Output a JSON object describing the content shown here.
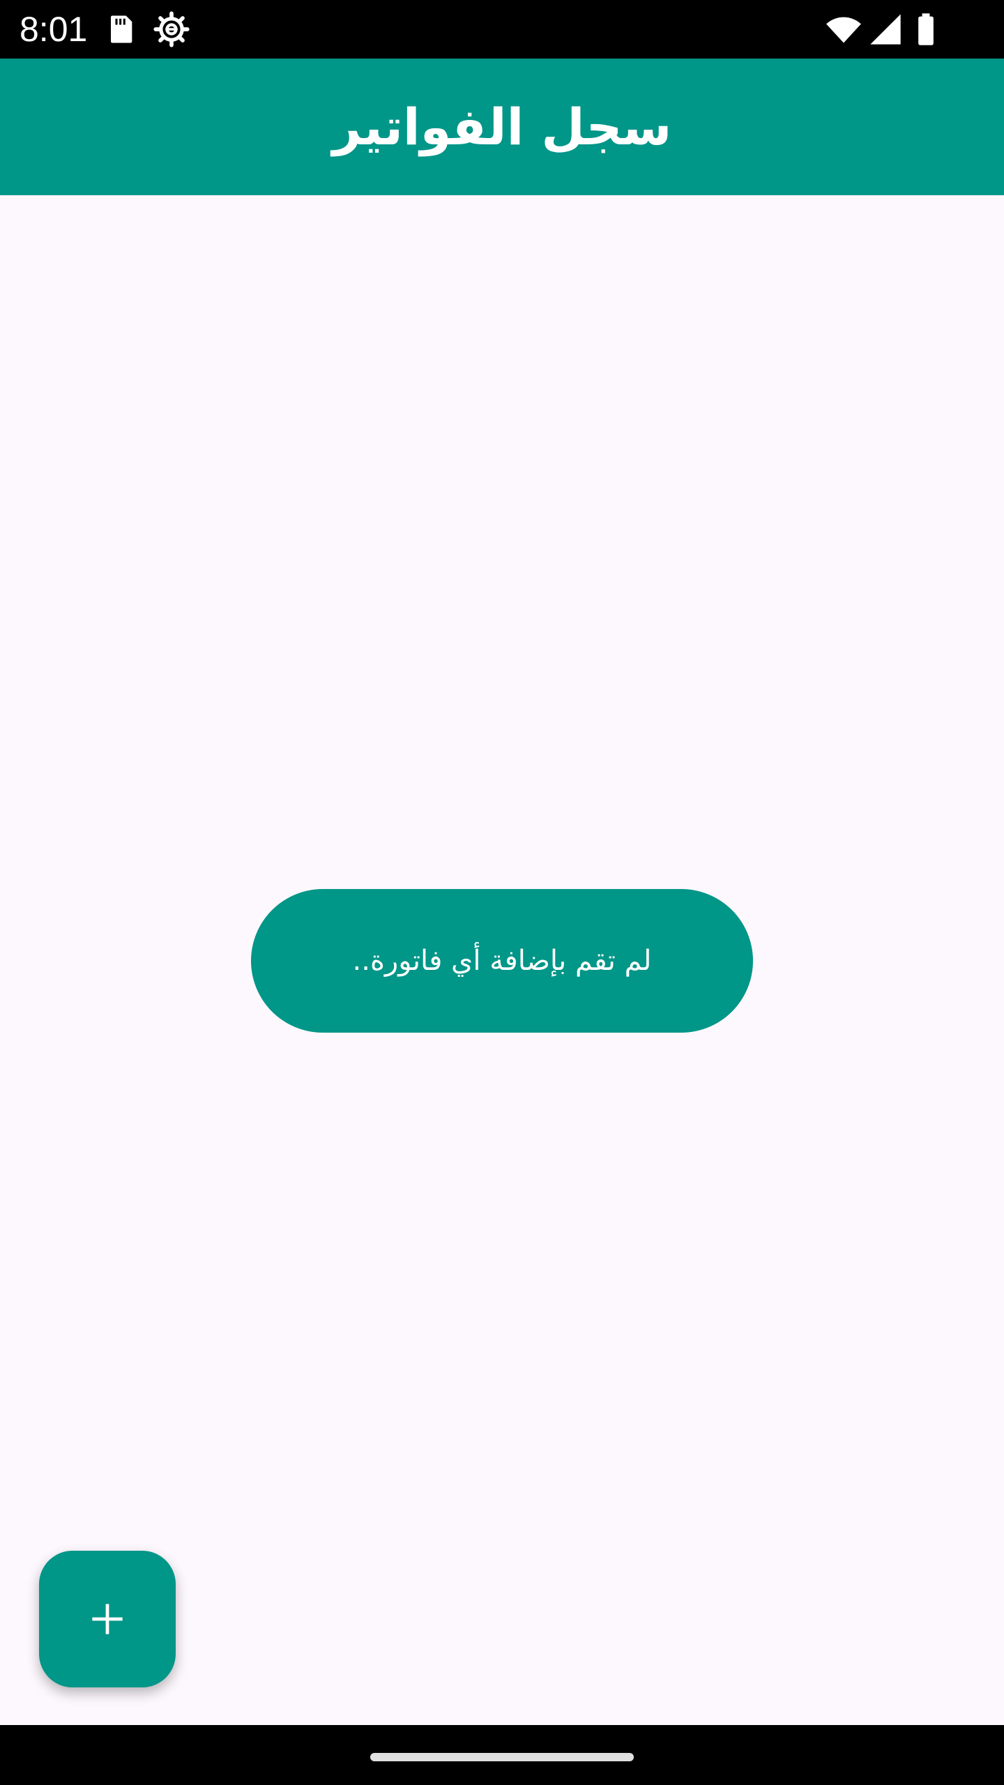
{
  "status_bar": {
    "time": "8:01",
    "icons": [
      "sd-card-icon",
      "settings-gear-icon",
      "wifi-icon",
      "cell-signal-icon",
      "battery-icon"
    ]
  },
  "app_bar": {
    "title": "سجل الفواتير"
  },
  "empty_state": {
    "message": "لم تقم بإضافة أي فاتورة.."
  },
  "fab": {
    "icon": "plus-icon"
  },
  "colors": {
    "primary": "#009688",
    "background": "#fdf8fd",
    "on_primary": "#ffffff",
    "system_bars": "#000000"
  }
}
